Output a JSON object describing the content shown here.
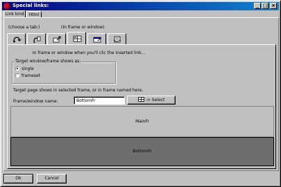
{
  "window": {
    "title": "Special links:",
    "buttons": {
      "minimize": "_",
      "maximize": "□",
      "close": "×"
    }
  },
  "top_tabs": [
    {
      "label": "Link kind"
    },
    {
      "label": "Html"
    }
  ],
  "header": {
    "hint": "(choose a tab:)",
    "current": "(In frame or window)"
  },
  "kind_tabs": [
    {
      "icon": "link-icon"
    },
    {
      "icon": "bookmark-icon"
    },
    {
      "icon": "external-link-icon"
    },
    {
      "icon": "frame-icon",
      "selected": true
    },
    {
      "icon": "window-icon"
    },
    {
      "icon": "mail-icon"
    }
  ],
  "body": {
    "description": "In frame or window  when you'll clic the inserted link...",
    "group_title": "Target window/frame shows as:",
    "options": [
      {
        "label": "single",
        "selected": true
      },
      {
        "label": "frameset",
        "selected": false
      }
    ],
    "target_info": "Target page shows in selected frame, or in frame named here.",
    "frame_name_label": "Frame/window name:",
    "frame_name_value": "BottomFr",
    "select_button": "-> Select"
  },
  "frames": {
    "main": "MainFr",
    "bottom": "BottomFr",
    "colors": {
      "main": "#c0c0c0",
      "bottom": "#6e6e6e"
    }
  },
  "footer": {
    "ok": "Ok",
    "cancel": "Cancel"
  }
}
